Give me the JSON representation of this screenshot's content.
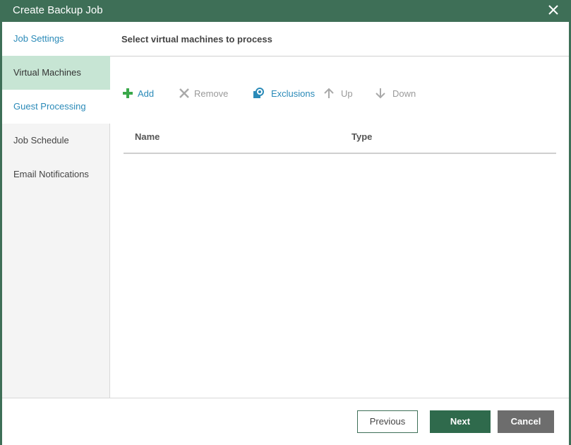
{
  "window": {
    "title": "Create Backup Job",
    "close_icon": "close-icon"
  },
  "sidebar": {
    "items": [
      {
        "label": "Job Settings",
        "state": "link"
      },
      {
        "label": "Virtual Machines",
        "state": "active"
      },
      {
        "label": "Guest Processing",
        "state": "link"
      },
      {
        "label": "Job Schedule",
        "state": "plain"
      },
      {
        "label": "Email Notifications",
        "state": "plain"
      }
    ]
  },
  "header": {
    "text": "Select virtual machines to process"
  },
  "toolbar": {
    "add": {
      "label": "Add",
      "icon": "plus-icon",
      "enabled": true
    },
    "remove": {
      "label": "Remove",
      "icon": "x-icon",
      "enabled": false
    },
    "exclusions": {
      "label": "Exclusions",
      "icon": "exclusions-icon",
      "enabled": true
    },
    "up": {
      "label": "Up",
      "icon": "arrow-up-icon",
      "enabled": false
    },
    "down": {
      "label": "Down",
      "icon": "arrow-down-icon",
      "enabled": false
    }
  },
  "grid": {
    "columns": [
      "Name",
      "Type"
    ],
    "rows": []
  },
  "footer": {
    "previous_label": "Previous",
    "next_label": "Next",
    "cancel_label": "Cancel"
  },
  "colors": {
    "title_bar": "#3e6f57",
    "active_nav": "#c7e5d4",
    "link": "#2a8ab8",
    "next_button": "#2f6a4c",
    "cancel_button": "#6d6d6d",
    "add_icon": "#3aa84a"
  }
}
